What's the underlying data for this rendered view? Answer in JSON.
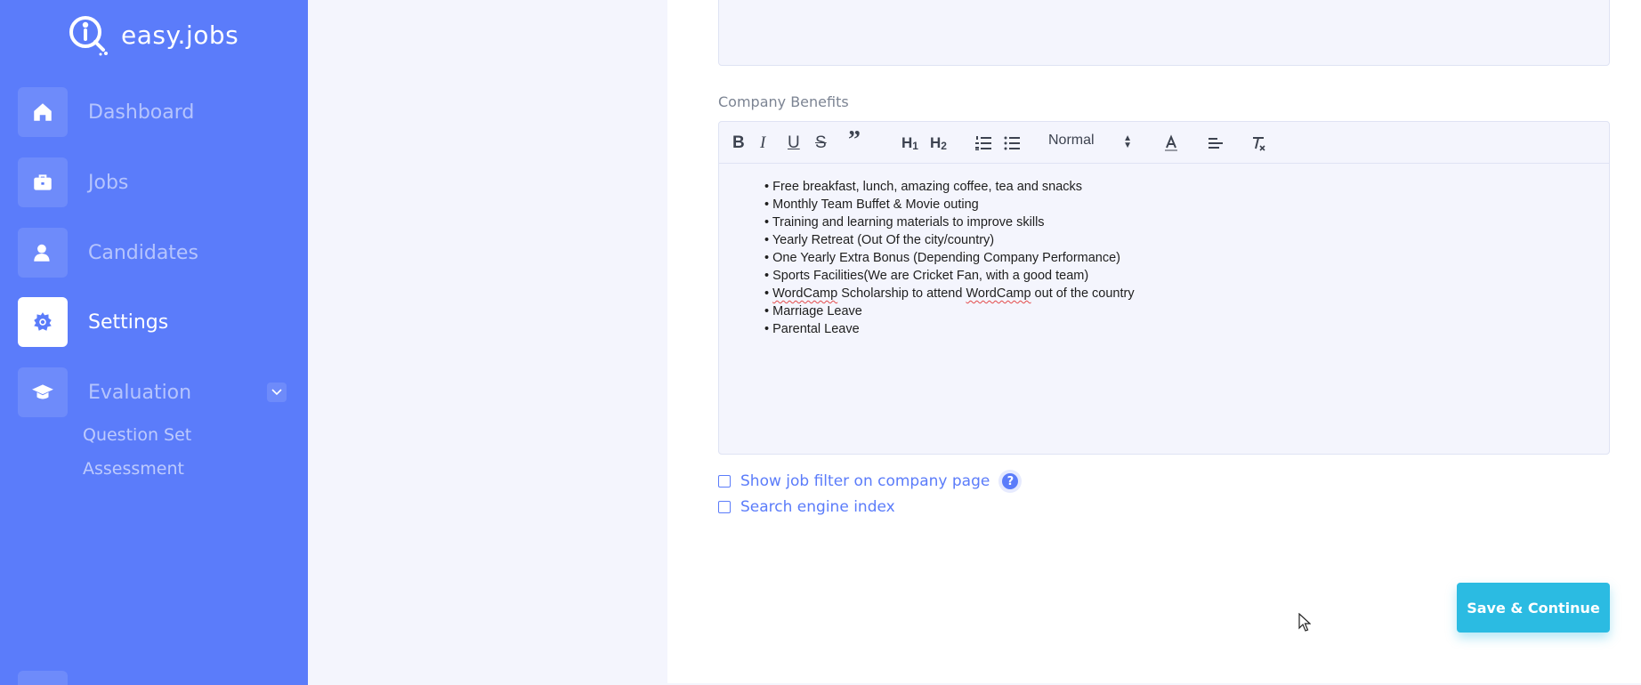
{
  "app": {
    "brand": "easy.jobs"
  },
  "colors": {
    "sidebar": "#5b7cfa",
    "accent": "#5b7cfa",
    "save_button": "#2bbbe2"
  },
  "sidebar": {
    "items": [
      {
        "label": "Dashboard",
        "icon": "home-icon"
      },
      {
        "label": "Jobs",
        "icon": "briefcase-icon"
      },
      {
        "label": "Candidates",
        "icon": "user-icon"
      },
      {
        "label": "Settings",
        "icon": "gear-icon",
        "active": true
      },
      {
        "label": "Evaluation",
        "icon": "graduation-cap-icon",
        "expanded": true
      }
    ],
    "sub_items": [
      {
        "label": "Question Set"
      },
      {
        "label": "Assessment"
      }
    ]
  },
  "form": {
    "benefits_label": "Company Benefits",
    "editor": {
      "toolbar": {
        "heading_select": "Normal",
        "h1": "H",
        "h2": "H",
        "h1_sub": "1",
        "h2_sub": "2",
        "bold": "B",
        "italic": "I",
        "underline": "U",
        "strike": "S",
        "quote": "”"
      },
      "items": [
        "Free breakfast, lunch, amazing coffee, tea and snacks",
        "Monthly Team Buffet & Movie outing",
        "Training and learning materials to improve skills",
        "Yearly Retreat (Out Of the city/country)",
        "One Yearly Extra Bonus (Depending Company Performance)",
        "Sports Facilities(We are Cricket Fan, with a good team)",
        "Marriage Leave",
        "Parental Leave"
      ],
      "wordcamp_item": {
        "w1": "WordCamp",
        "mid": " Scholarship to attend ",
        "w2": "WordCamp",
        "end": " out of the country"
      }
    },
    "checkboxes": [
      {
        "label": "Show job filter on company page",
        "checked": false,
        "help": "?"
      },
      {
        "label": "Search engine index",
        "checked": false
      }
    ],
    "save_button": "Save & Continue"
  }
}
